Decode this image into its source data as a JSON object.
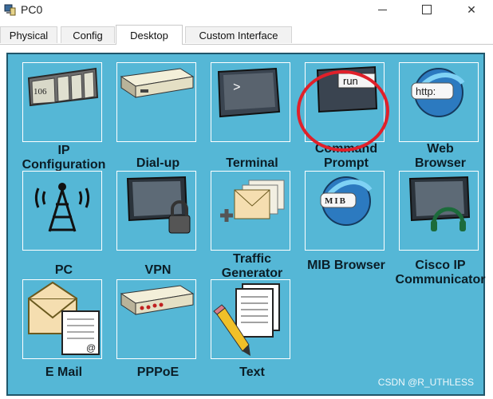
{
  "window": {
    "title": "PC0",
    "minimize_icon": "minimize-icon",
    "maximize_icon": "maximize-icon",
    "close_icon": "close-icon",
    "close_glyph": "✕"
  },
  "tabs": [
    {
      "label": "Physical",
      "active": false
    },
    {
      "label": "Config",
      "active": false
    },
    {
      "label": "Desktop",
      "active": true
    },
    {
      "label": "Custom Interface",
      "active": false
    }
  ],
  "desktop": {
    "background_color": "#55b7d6",
    "apps": [
      {
        "label": "IP\nConfiguration",
        "icon": "ip-configuration-icon",
        "icon_text": "106"
      },
      {
        "label": "Dial-up",
        "icon": "dialup-modem-icon"
      },
      {
        "label": "Terminal",
        "icon": "terminal-icon",
        "icon_text": ">"
      },
      {
        "label": "Command\nPrompt",
        "icon": "command-prompt-icon",
        "icon_text": "run"
      },
      {
        "label": "Web\nBrowser",
        "icon": "web-browser-icon",
        "icon_text": "http:"
      },
      {
        "label": "PC",
        "icon": "wireless-tower-icon"
      },
      {
        "label": "VPN",
        "icon": "vpn-lock-icon"
      },
      {
        "label": "Traffic\nGenerator",
        "icon": "traffic-generator-icon"
      },
      {
        "label": "MIB Browser",
        "icon": "mib-browser-icon",
        "icon_text": "MIB"
      },
      {
        "label": "Cisco IP\nCommunicator",
        "icon": "cisco-ip-communicator-icon"
      },
      {
        "label": "E Mail",
        "icon": "email-icon",
        "icon_text": "@"
      },
      {
        "label": "PPPoE",
        "icon": "pppoe-device-icon"
      },
      {
        "label": "Text",
        "icon": "text-editor-icon"
      }
    ]
  },
  "annotation": {
    "color": "#e0202a"
  },
  "watermark": "CSDN @R_UTHLESS"
}
